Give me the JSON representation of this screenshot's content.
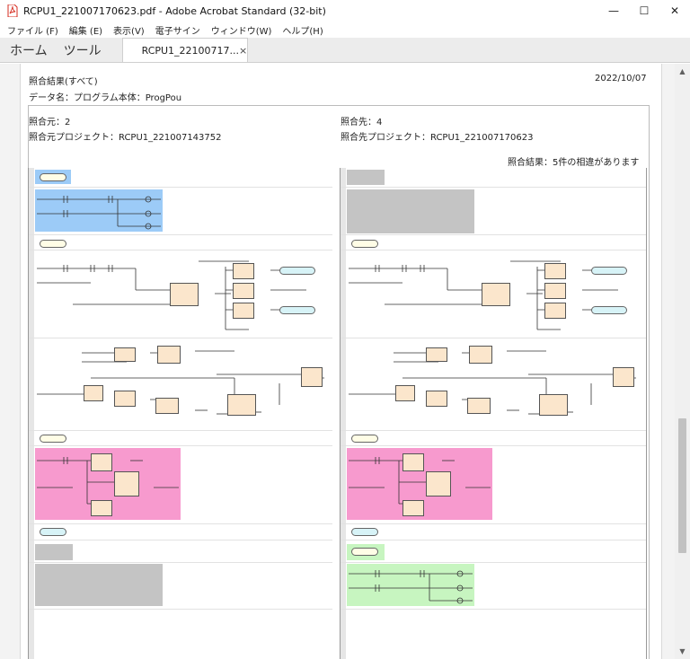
{
  "window": {
    "title": "RCPU1_221007170623.pdf - Adobe Acrobat Standard (32-bit)",
    "min_glyph": "—",
    "max_glyph": "☐",
    "close_glyph": "✕"
  },
  "menu": [
    "ファイル (F)",
    "編集 (E)",
    "表示(V)",
    "電子サイン",
    "ウィンドウ(W)",
    "ヘルプ(H)"
  ],
  "tabs": {
    "home": "ホーム",
    "tools": "ツール",
    "doc_tab": "RCPU1_22100717...",
    "doc_close": "×"
  },
  "report": {
    "heading": "照合結果(すべて)",
    "date": "2022/10/07",
    "data_name": "データ名：プログラム本体：ProgPou",
    "source_label": "照合元：2",
    "source_project": "照合元プロジェクト：RCPU1_221007143752",
    "dest_label": "照合先：4",
    "dest_project": "照合先プロジェクト：RCPU1_221007170623",
    "result": "照合結果：5件の相違があります"
  },
  "colors": {
    "diff_blue": "#9ccbf7",
    "diff_gray": "#c4c4c4",
    "diff_pink": "#f79ace",
    "diff_green": "#c7f5c0",
    "fb_block": "#fbe6cc"
  }
}
